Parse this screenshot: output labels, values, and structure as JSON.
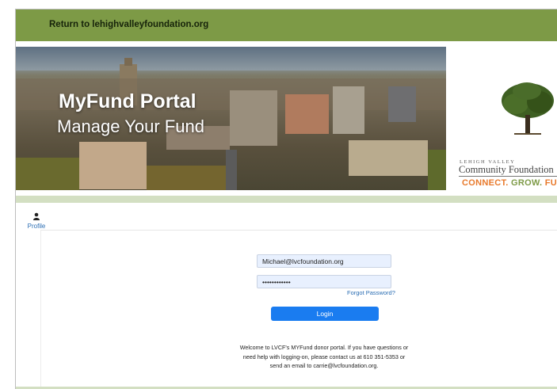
{
  "header": {
    "return_link": "Return to lehighvalleyfoundation.org"
  },
  "hero": {
    "title": "MyFund Portal",
    "subtitle": "Manage Your Fund"
  },
  "logo": {
    "small_text": "LEHIGH VALLEY",
    "name": "Community Foundation",
    "tagline_part1": "CONNECT. ",
    "tagline_part2": "GROW. ",
    "tagline_part3": "FUND.",
    "colors": {
      "green": "#7d9a46",
      "orange": "#e8792b"
    }
  },
  "profile": {
    "label": "Profile",
    "icon": "person-icon"
  },
  "login": {
    "email_value": "Michael@lvcfoundation.org",
    "password_value": "••••••••••••",
    "forgot_label": "Forgot Password?",
    "login_label": "Login",
    "welcome_text": "Welcome to LVCF's MYFund donor portal. If you have questions or need help with logging-on, please contact us at 610 351-5353 or send an email to carrie@lvcfoundation.org."
  },
  "colors": {
    "topbar": "#7d9a46",
    "band": "#d3dfc2",
    "button": "#1a7cf0",
    "input_bg": "#e8f0fe"
  }
}
